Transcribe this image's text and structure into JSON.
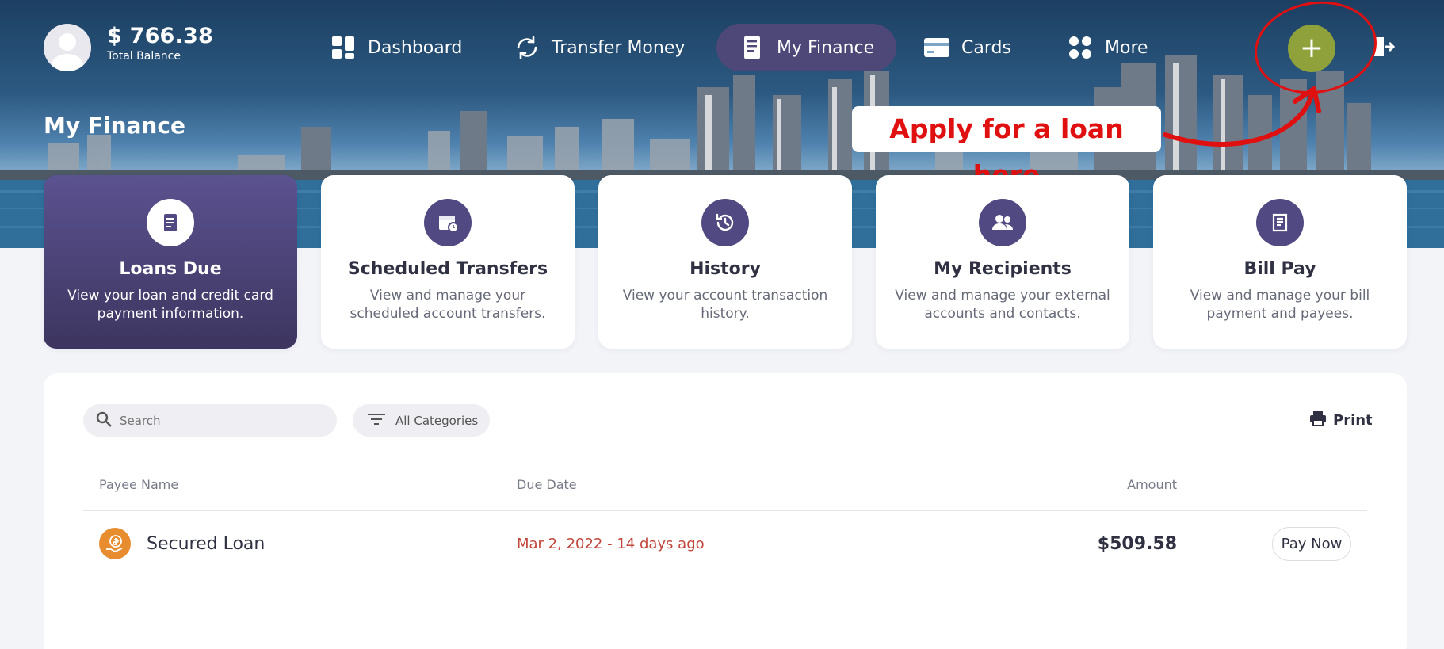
{
  "user": {
    "balance": "$ 766.38",
    "balance_label": "Total Balance"
  },
  "nav": {
    "dashboard": "Dashboard",
    "transfer": "Transfer Money",
    "finance": "My Finance",
    "cards": "Cards",
    "more": "More"
  },
  "actions": {
    "add": "+"
  },
  "annotation": "Apply for a loan here",
  "page_title": "My Finance",
  "cards": [
    {
      "title": "Loans Due",
      "desc": "View your loan and credit card payment information."
    },
    {
      "title": "Scheduled Transfers",
      "desc": "View and manage your scheduled account transfers."
    },
    {
      "title": "History",
      "desc": "View your account transaction history."
    },
    {
      "title": "My Recipients",
      "desc": "View and manage your external accounts and contacts."
    },
    {
      "title": "Bill Pay",
      "desc": "View and manage your bill payment and payees."
    }
  ],
  "toolbar": {
    "search_placeholder": "Search",
    "filter_label": "All Categories",
    "print_label": "Print"
  },
  "table": {
    "headers": {
      "payee": "Payee Name",
      "due": "Due Date",
      "amount": "Amount"
    },
    "rows": [
      {
        "payee": "Secured Loan",
        "due": "Mar 2, 2022 - 14 days ago",
        "amount": "$509.58",
        "action": "Pay Now"
      }
    ]
  },
  "colors": {
    "accent": "#514a82",
    "add_button": "#8fa13a",
    "overdue": "#c0453b",
    "annotation": "#e01010",
    "loan_icon": "#e88d2f"
  }
}
